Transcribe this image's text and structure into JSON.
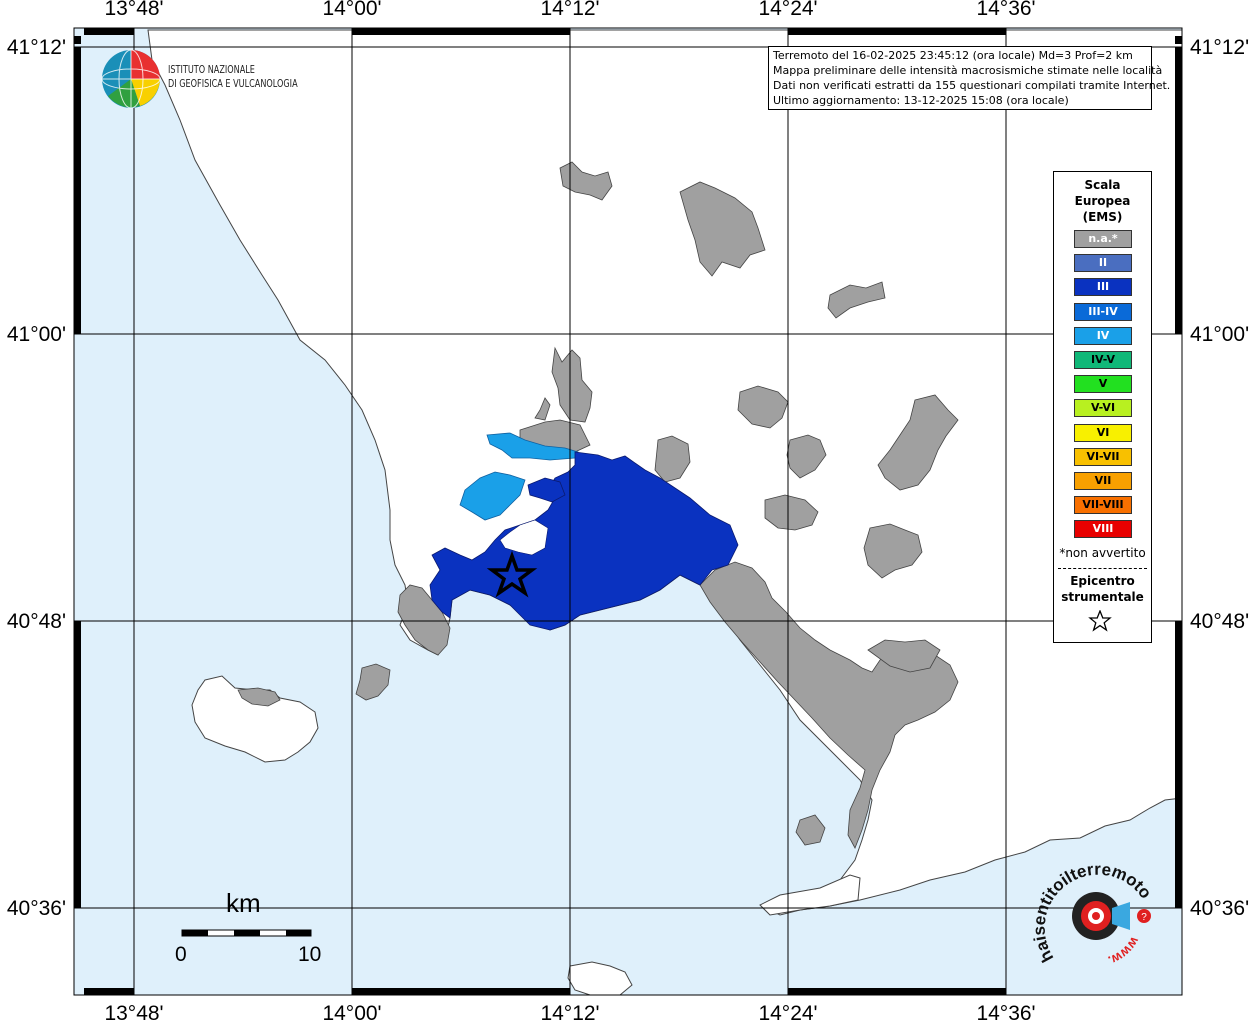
{
  "map": {
    "lon_labels": [
      "13°48'",
      "14°00'",
      "14°12'",
      "14°24'",
      "14°36'"
    ],
    "lat_labels": [
      "41°12'",
      "41°00'",
      "40°48'",
      "40°36'"
    ],
    "colors": {
      "sea": "#dff0fb",
      "land": "#ffffff",
      "na": "#a0a0a0",
      "grade_III": "#0a32c0",
      "grade_IV": "#1aa0e8",
      "epicenter": "#000000"
    }
  },
  "institute": {
    "line1": "ISTITUTO NAZIONALE",
    "line2": "DI GEOFISICA E VULCANOLOGIA"
  },
  "info": {
    "line1": "Terremoto del 16-02-2025 23:45:12 (ora locale) Md=3 Prof=2 km",
    "line2": "Mappa preliminare delle intensità macrosismiche stimate nelle località",
    "line3": "Dati non verificati estratti da 155 questionari compilati tramite Internet.",
    "line4": "Ultimo aggiornamento: 13-12-2025 15:08 (ora locale)"
  },
  "legend": {
    "title1": "Scala",
    "title2": "Europea",
    "title3": "(EMS)",
    "items": [
      {
        "label": "n.a.*",
        "color": "#a0a0a0",
        "text_color": "#ffffff"
      },
      {
        "label": "II",
        "color": "#4a6ec0",
        "text_color": "#ffffff"
      },
      {
        "label": "III",
        "color": "#0a32c0",
        "text_color": "#ffffff"
      },
      {
        "label": "III-IV",
        "color": "#0a6ad8",
        "text_color": "#ffffff"
      },
      {
        "label": "IV",
        "color": "#1aa0e8",
        "text_color": "#ffffff"
      },
      {
        "label": "IV-V",
        "color": "#10b878",
        "text_color": "#000000"
      },
      {
        "label": "V",
        "color": "#22e020",
        "text_color": "#000000"
      },
      {
        "label": "V-VI",
        "color": "#b8f020",
        "text_color": "#000000"
      },
      {
        "label": "VI",
        "color": "#f8f000",
        "text_color": "#000000"
      },
      {
        "label": "VI-VII",
        "color": "#f8c000",
        "text_color": "#000000"
      },
      {
        "label": "VII",
        "color": "#f8a000",
        "text_color": "#000000"
      },
      {
        "label": "VII-VIII",
        "color": "#f87000",
        "text_color": "#000000"
      },
      {
        "label": "VIII",
        "color": "#e80000",
        "text_color": "#ffffff"
      }
    ],
    "note": "*non avvertito",
    "epi1": "Epicentro",
    "epi2": "strumentale"
  },
  "scalebar": {
    "unit": "km",
    "start": "0",
    "end": "10"
  },
  "badge": {
    "text": "haisentitoilterremoto.it",
    "url": "www."
  }
}
